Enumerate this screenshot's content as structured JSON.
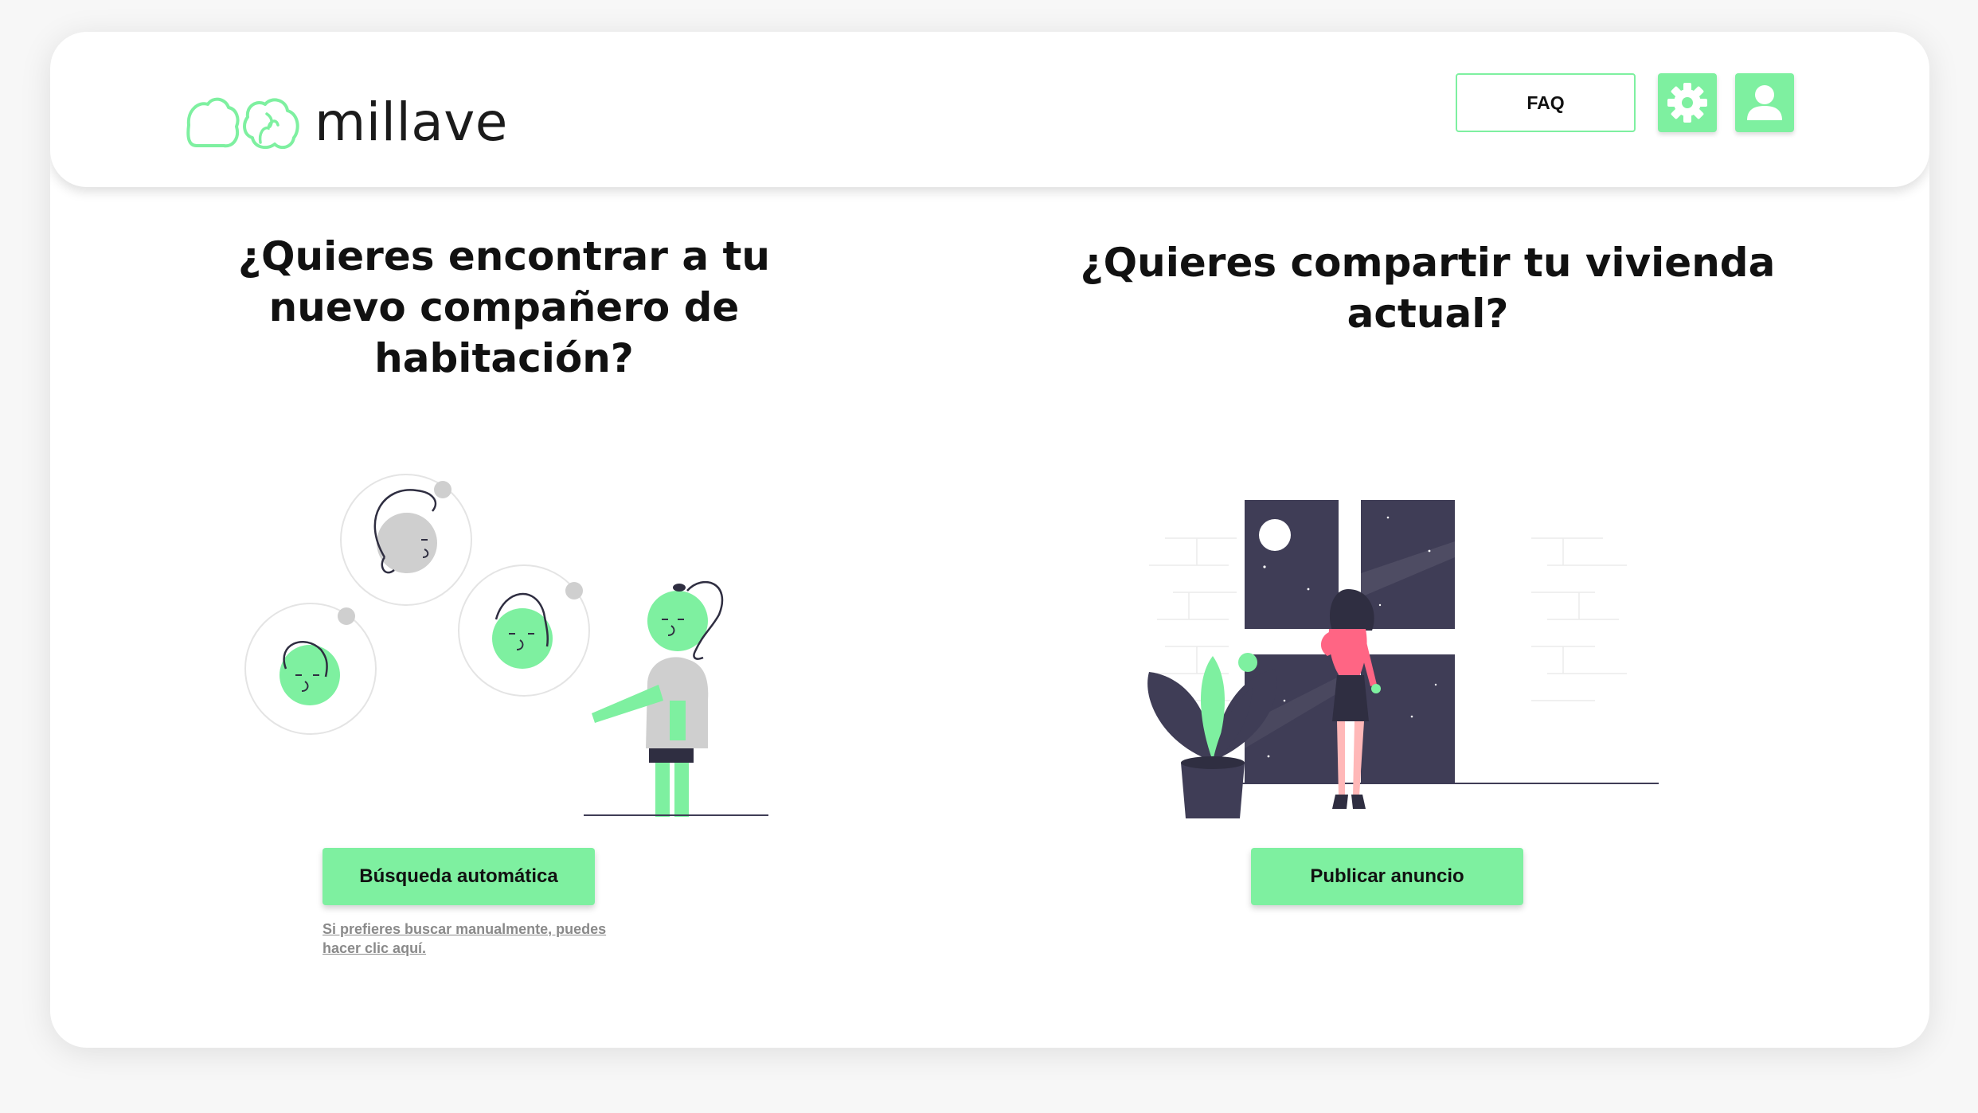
{
  "brand": {
    "name": "millave",
    "accent_color": "#7ef0a0"
  },
  "header": {
    "faq_label": "FAQ",
    "settings_icon": "gear-icon",
    "profile_icon": "user-icon"
  },
  "left_panel": {
    "title": "¿Quieres encontrar a tu nuevo compañero de habitación?",
    "button_label": "Búsqueda automática",
    "manual_link": "Si prefieres buscar manualmente, puedes hacer clic aquí."
  },
  "right_panel": {
    "title": "¿Quieres compartir tu vivienda actual?",
    "button_label": "Publicar anuncio"
  }
}
